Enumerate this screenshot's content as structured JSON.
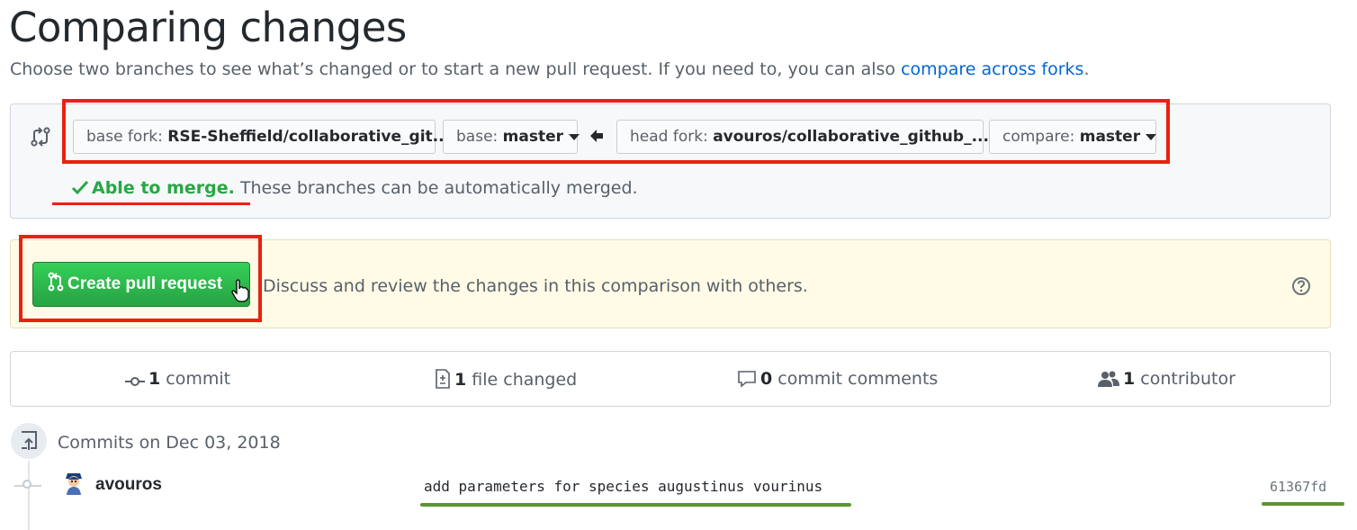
{
  "page": {
    "title": "Comparing changes",
    "subtitle_text": "Choose two branches to see what’s changed or to start a new pull request. If you need to, you can also ",
    "subtitle_link": "compare across forks",
    "subtitle_end": "."
  },
  "range": {
    "base_fork_label": "base fork:",
    "base_fork_value": "RSE-Sheffield/collaborative_git...",
    "base_label": "base:",
    "base_value": "master",
    "head_fork_label": "head fork:",
    "head_fork_value": "avouros/collaborative_github_...",
    "compare_label": "compare:",
    "compare_value": "master",
    "merge_status": "Able to merge.",
    "merge_message": "These branches can be automatically merged."
  },
  "pull_request": {
    "button_label": "Create pull request",
    "description": "Discuss and review the changes in this comparison with others."
  },
  "summary": {
    "commits_count": "1",
    "commits_label": "commit",
    "files_count": "1",
    "files_label": "file changed",
    "comments_count": "0",
    "comments_label": "commit comments",
    "contributors_count": "1",
    "contributors_label": "contributor"
  },
  "commits": {
    "date_heading": "Commits on Dec 03, 2018",
    "items": [
      {
        "author": "avouros",
        "message": "add parameters for species augustinus vourinus",
        "sha": "61367fd"
      }
    ]
  },
  "colors": {
    "annotation_red": "#e8220f",
    "annotation_green": "#5d9431",
    "merge_green": "#28a745",
    "link_blue": "#0366d6"
  }
}
